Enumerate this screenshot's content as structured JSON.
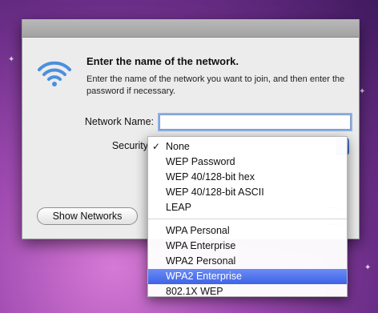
{
  "dialog": {
    "title": "Enter the name of the network.",
    "description": "Enter the name of the network you want to join, and then enter the password if necessary.",
    "network_name_label": "Network Name:",
    "network_name_value": "",
    "security_label": "Security",
    "show_networks_label": "Show Networks"
  },
  "security_menu": {
    "checked": "None",
    "highlighted": "WPA2 Enterprise",
    "group1": [
      "None",
      "WEP Password",
      "WEP 40/128-bit hex",
      "WEP 40/128-bit ASCII",
      "LEAP"
    ],
    "group2": [
      "WPA Personal",
      "WPA Enterprise",
      "WPA2 Personal",
      "WPA2 Enterprise",
      "802.1X WEP"
    ]
  },
  "colors": {
    "accent": "#3d63e6",
    "wifi": "#4a8fdf",
    "background": "#a04bb2"
  },
  "icons": {
    "wifi": "wifi-icon",
    "check": "checkmark-icon"
  }
}
